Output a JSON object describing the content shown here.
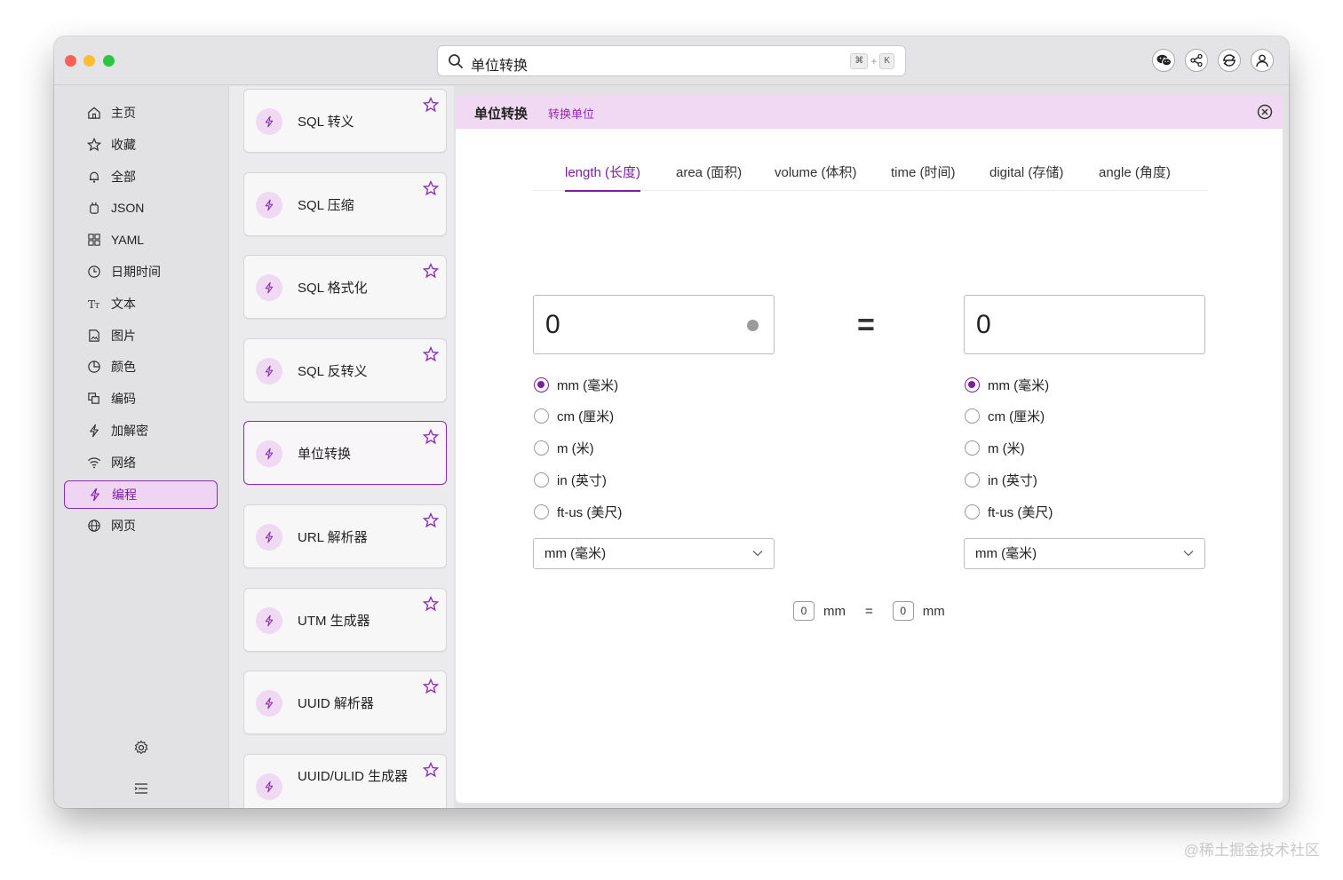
{
  "search": {
    "query": "单位转换",
    "shortcut_cmd": "⌘",
    "shortcut_plus": "+",
    "shortcut_key": "K"
  },
  "toolbar_icons": [
    "wechat-icon",
    "share-icon",
    "sync-icon",
    "user-icon"
  ],
  "sidebar": {
    "items": [
      {
        "label": "主页",
        "icon": "home-icon"
      },
      {
        "label": "收藏",
        "icon": "star-icon"
      },
      {
        "label": "全部",
        "icon": "bell-icon"
      },
      {
        "label": "JSON",
        "icon": "json-icon"
      },
      {
        "label": "YAML",
        "icon": "grid-icon"
      },
      {
        "label": "日期时间",
        "icon": "clock-icon"
      },
      {
        "label": "文本",
        "icon": "text-icon"
      },
      {
        "label": "图片",
        "icon": "image-icon"
      },
      {
        "label": "颜色",
        "icon": "palette-icon"
      },
      {
        "label": "编码",
        "icon": "copy-icon"
      },
      {
        "label": "加解密",
        "icon": "bolt-icon"
      },
      {
        "label": "网络",
        "icon": "wifi-icon"
      },
      {
        "label": "编程",
        "icon": "bolt-icon",
        "active": true
      },
      {
        "label": "网页",
        "icon": "globe-icon"
      }
    ],
    "bottom_icons": [
      "settings-icon",
      "menu-icon"
    ]
  },
  "tools": [
    {
      "label": "SQL 转义"
    },
    {
      "label": "SQL 压缩"
    },
    {
      "label": "SQL 格式化"
    },
    {
      "label": "SQL 反转义"
    },
    {
      "label": "单位转换",
      "active": true
    },
    {
      "label": "URL 解析器"
    },
    {
      "label": "UTM 生成器"
    },
    {
      "label": "UUID 解析器"
    },
    {
      "label": "UUID/ULID 生成器"
    }
  ],
  "main": {
    "title": "单位转换",
    "subtitle": "转换单位",
    "tabs": [
      {
        "label": "length (长度)",
        "active": true
      },
      {
        "label": "area (面积)"
      },
      {
        "label": "volume (体积)"
      },
      {
        "label": "time (时间)"
      },
      {
        "label": "digital (存储)"
      },
      {
        "label": "angle (角度)"
      }
    ],
    "left_value": "0",
    "right_value": "0",
    "equals": "=",
    "units": [
      "mm (毫米)",
      "cm (厘米)",
      "m (米)",
      "in (英寸)",
      "ft-us (美尺)"
    ],
    "left_selected_index": 0,
    "right_selected_index": 0,
    "left_select": "mm (毫米)",
    "right_select": "mm (毫米)",
    "summary": {
      "left_value": "0",
      "left_unit": "mm",
      "eq": "=",
      "right_value": "0",
      "right_unit": "mm"
    }
  },
  "colors": {
    "accent": "#7a1fa2",
    "accent_bg": "#f1d9f4"
  },
  "watermark": "@稀土掘金技术社区"
}
